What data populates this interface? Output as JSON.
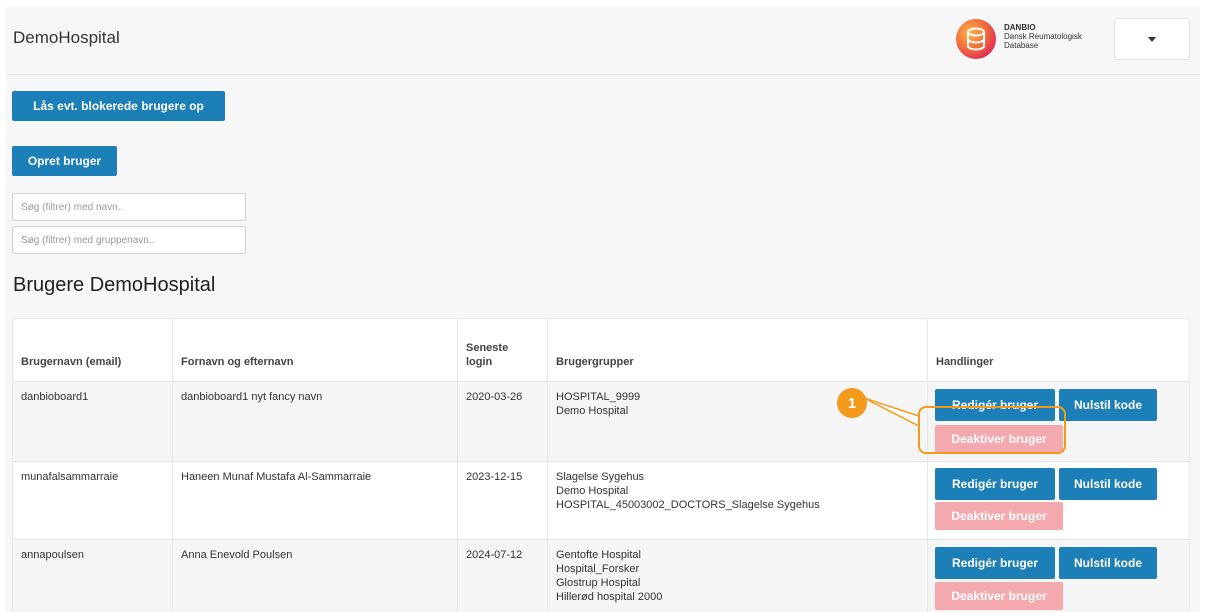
{
  "header": {
    "brand": "DemoHospital",
    "logo": {
      "line1": "DANBIO",
      "line2": "Dansk Reumatologisk",
      "line3": "Database"
    }
  },
  "actions": {
    "unlock_label": "Lås evt. blokerede brugere op",
    "create_label": "Opret bruger"
  },
  "filters": {
    "name_placeholder": "Søg (filtrer) med navn..",
    "group_placeholder": "Søg (filtrer) med gruppenavn.."
  },
  "section_title": "Brugere DemoHospital",
  "table": {
    "columns": {
      "username": "Brugernavn (email)",
      "fullname": "Fornavn og efternavn",
      "last_login_1": "Seneste",
      "last_login_2": "login",
      "groups": "Brugergrupper",
      "actions": "Handlinger"
    },
    "buttons": {
      "edit": "Redigér bruger",
      "reset": "Nulstil kode",
      "deactivate": "Deaktiver bruger"
    },
    "rows": [
      {
        "username": "danbioboard1",
        "fullname": "danbioboard1 nyt fancy navn",
        "last_login": "2020-03-26",
        "groups": [
          "HOSPITAL_9999",
          "Demo Hospital"
        ]
      },
      {
        "username": "munafalsammarraie",
        "fullname": "Haneen Munaf Mustafa Al-Sammarraie",
        "last_login": "2023-12-15",
        "groups": [
          "Slagelse Sygehus",
          "Demo Hospital",
          "HOSPITAL_45003002_DOCTORS_Slagelse Sygehus"
        ]
      },
      {
        "username": "annapoulsen",
        "fullname": "Anna Enevold Poulsen",
        "last_login": "2024-07-12",
        "groups": [
          "Gentofte Hospital",
          "Hospital_Forsker",
          "Glostrup Hospital",
          "Hillerød hospital 2000"
        ]
      }
    ]
  },
  "callout": {
    "number": "1",
    "color": "#f39a1d"
  },
  "colors": {
    "primary": "#1d7fb8",
    "disabled": "#f4a9ae"
  }
}
